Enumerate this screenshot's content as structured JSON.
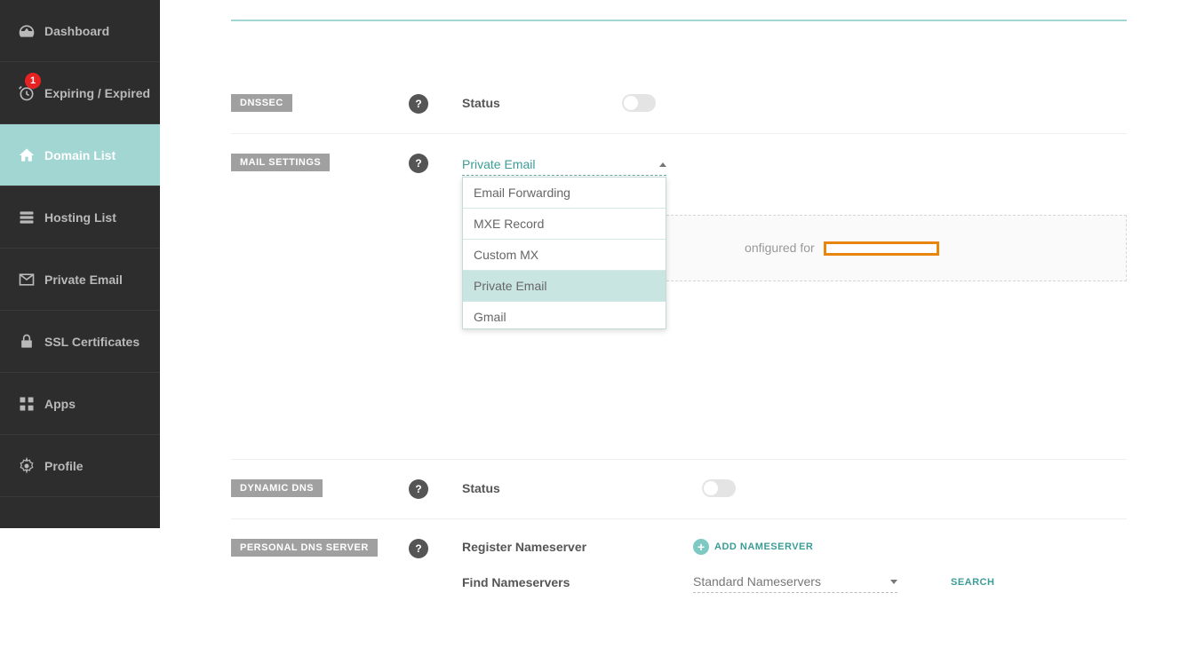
{
  "sidebar": {
    "items": [
      {
        "label": "Dashboard"
      },
      {
        "label": "Expiring / Expired",
        "badge": "1"
      },
      {
        "label": "Domain List"
      },
      {
        "label": "Hosting List"
      },
      {
        "label": "Private Email"
      },
      {
        "label": "SSL Certificates"
      },
      {
        "label": "Apps"
      },
      {
        "label": "Profile"
      }
    ]
  },
  "sections": {
    "dnssec": {
      "tag": "DNSSEC",
      "label": "Status"
    },
    "mail": {
      "tag": "MAIL SETTINGS",
      "selected": "Private Email",
      "options": [
        "Email Forwarding",
        "MXE Record",
        "Custom MX",
        "Private Email",
        "Gmail"
      ],
      "info_prefix": "onfigured for"
    },
    "ddns": {
      "tag": "DYNAMIC DNS",
      "label": "Status"
    },
    "pdns": {
      "tag": "PERSONAL DNS SERVER",
      "register_label": "Register Nameserver",
      "add_label": "ADD NAMESERVER",
      "find_label": "Find Nameservers",
      "ns_selected": "Standard Nameservers",
      "search_label": "SEARCH"
    }
  }
}
